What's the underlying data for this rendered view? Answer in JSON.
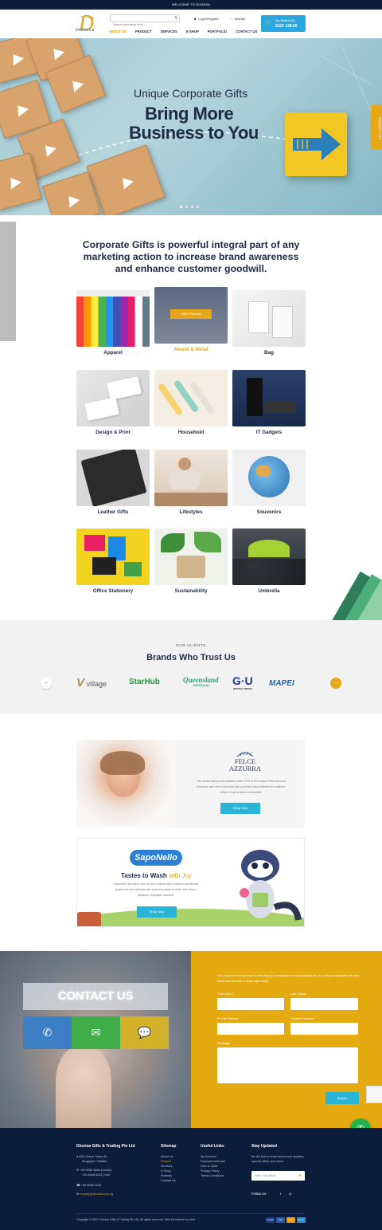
{
  "topbar": {
    "text": "WELCOME TO DIONISA"
  },
  "header": {
    "logo_text": "DIONISA",
    "search_placeholder": "Search products here...",
    "login": "Login/Register",
    "wishlist": "Wishlist",
    "basket_label": "My Basket (0)",
    "basket_total": "SGD 128.00",
    "nav": [
      "ABOUT US",
      "PRODUCT",
      "SERVICES",
      "E-SHOP",
      "PORTFOLIO",
      "CONTACT US"
    ]
  },
  "hero": {
    "subtitle": "Unique Corporate Gifts",
    "title_line1": "Bring More",
    "title_line2": "Business to You",
    "side_tab": "ENQUIRY LIST"
  },
  "intro": {
    "text": "Corporate Gifts is powerful integral part of any marketing action to increase brand awareness and enhance customer goodwill."
  },
  "categories": {
    "view_products": "View Products",
    "items": [
      {
        "label": "Apparel"
      },
      {
        "label": "Award & Metal"
      },
      {
        "label": "Bag"
      },
      {
        "label": "Design & Print"
      },
      {
        "label": "Household"
      },
      {
        "label": "IT Gadgets"
      },
      {
        "label": "Leather Gifts"
      },
      {
        "label": "Lifestyles"
      },
      {
        "label": "Souvenirs"
      },
      {
        "label": "Office Stationery"
      },
      {
        "label": "Sustainability"
      },
      {
        "label": "Umbrella"
      }
    ]
  },
  "brands": {
    "eyebrow": "OUR CLIENTS",
    "title": "Brands Who Trust Us",
    "logos": [
      "village",
      "StarHub",
      "Queensland",
      "G·U",
      "MAPEI"
    ],
    "queensland_sub": "AUSTRALIA",
    "gu_sub": "BRITISH UNITED"
  },
  "promo1": {
    "brand": "FELCE AZZURRA",
    "description": "The whole history and tradition since 1970 of the unique Felce Azzurra personal care and household care products have entered the wellness culture of generations of families.",
    "button": "Shop Now"
  },
  "promo2": {
    "brand": "SapoNello",
    "title_main": "Tastes to Wash",
    "title_accent": "with Joy",
    "description": "Saponello first takes care of your children with products specifically studied for their delicate skin and formulated to make bath time a pleasant, enjoyable moment.",
    "button": "Shop Now"
  },
  "contact": {
    "title": "CONTACT US",
    "intro": "Our customer service team is standing by to help take the best solution for you. Help us complete the form below and we'll be in touch right away.",
    "first_name": "First Name",
    "last_name": "Last Name",
    "email": "E-mail Address",
    "contact_number": "Contact Number",
    "message": "Message",
    "submit": "Submit"
  },
  "footer": {
    "company": "Dionisa Gifts & Trading Pte Ltd",
    "address_line1": "606 Yishun Street 81",
    "address_line2": "Singapore 768894",
    "phone1": "+65 9060 3888 (Lizelle)",
    "phone2": "+65 8468 5232 (Yee)",
    "fax": "+65 6555 3430",
    "email": "enquiry@dionisa.com.sg",
    "sitemap_title": "Sitemap",
    "sitemap": [
      "About Us",
      "Product",
      "Services",
      "E-Shop",
      "Portfolio",
      "Contact Us"
    ],
    "useful_title": "Useful Links",
    "useful": [
      "My Account",
      "Payment methods",
      "How to order",
      "Privacy Policy",
      "Terms Conditions"
    ],
    "stay_title": "Stay Updated",
    "stay_text": "Be the first to know about new updates, special offers and much",
    "newsletter_placeholder": "Enter Your Email",
    "follow": "Follow Us",
    "copyright": "Copyright © 2021 Dionisa Gifts & Trading Pte Ltd. All rights reserved. Web Excellence by Veni",
    "payments": [
      "PayPal",
      "Visa",
      "MC",
      "Amex"
    ]
  },
  "colors": {
    "navy": "#0c1d3c",
    "accent": "#e0a31a",
    "blue": "#29b4d8",
    "contact_yellow": "#e5aa0f"
  }
}
